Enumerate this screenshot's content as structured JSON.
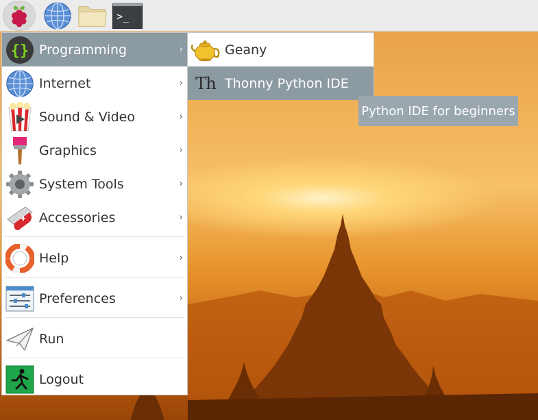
{
  "panel": {
    "buttons": [
      {
        "name": "raspberry-menu",
        "icon": "raspberry-icon"
      },
      {
        "name": "browser",
        "icon": "globe-icon"
      },
      {
        "name": "file-manager",
        "icon": "folder-icon"
      },
      {
        "name": "terminal",
        "icon": "terminal-icon",
        "text": ">_"
      }
    ]
  },
  "menu": {
    "items": [
      {
        "label": "Programming",
        "icon": "code-braces-icon",
        "arrow": "›"
      },
      {
        "label": "Internet",
        "icon": "globe-icon",
        "arrow": "›"
      },
      {
        "label": "Sound & Video",
        "icon": "popcorn-icon",
        "arrow": "›"
      },
      {
        "label": "Graphics",
        "icon": "paintbrush-icon",
        "arrow": "›"
      },
      {
        "label": "System Tools",
        "icon": "gear-icon",
        "arrow": "›"
      },
      {
        "label": "Accessories",
        "icon": "swiss-knife-icon",
        "arrow": "›"
      },
      {
        "label": "Help",
        "icon": "lifebuoy-icon",
        "arrow": "›"
      },
      {
        "label": "Preferences",
        "icon": "sliders-icon",
        "arrow": "›"
      },
      {
        "label": "Run",
        "icon": "paper-plane-icon"
      },
      {
        "label": "Logout",
        "icon": "exit-icon"
      }
    ]
  },
  "submenu": {
    "items": [
      {
        "label": "Geany",
        "icon": "teapot-icon"
      },
      {
        "label": "Thonny Python IDE",
        "icon": "thonny-icon",
        "glyph": "Th"
      }
    ]
  },
  "tooltip": {
    "text": "Python IDE for beginners"
  },
  "colors": {
    "selection": "#8c9aa1",
    "tooltip_bg": "#9aa7ad",
    "panel_bg": "#ececec",
    "code_green": "#7ed321"
  }
}
